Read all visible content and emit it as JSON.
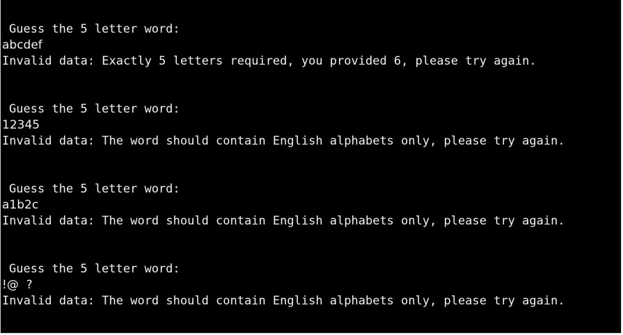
{
  "terminal": {
    "background": "#000000",
    "foreground": "#f0f0f0",
    "attempts": [
      {
        "prompt": "Guess the 5 letter word:",
        "input": "abcdef",
        "error": "Invalid data: Exactly 5 letters required, you provided 6, please try again."
      },
      {
        "prompt": "Guess the 5 letter word:",
        "input": "12345",
        "error": "Invalid data: The word should contain English alphabets only, please try again."
      },
      {
        "prompt": "Guess the 5 letter word:",
        "input": "a1b2c",
        "error": "Invalid data: The word should contain English alphabets only, please try again."
      },
      {
        "prompt": "Guess the 5 letter word:",
        "input": "!@  ?",
        "error": "Invalid data: The word should contain English alphabets only, please try again."
      }
    ]
  }
}
